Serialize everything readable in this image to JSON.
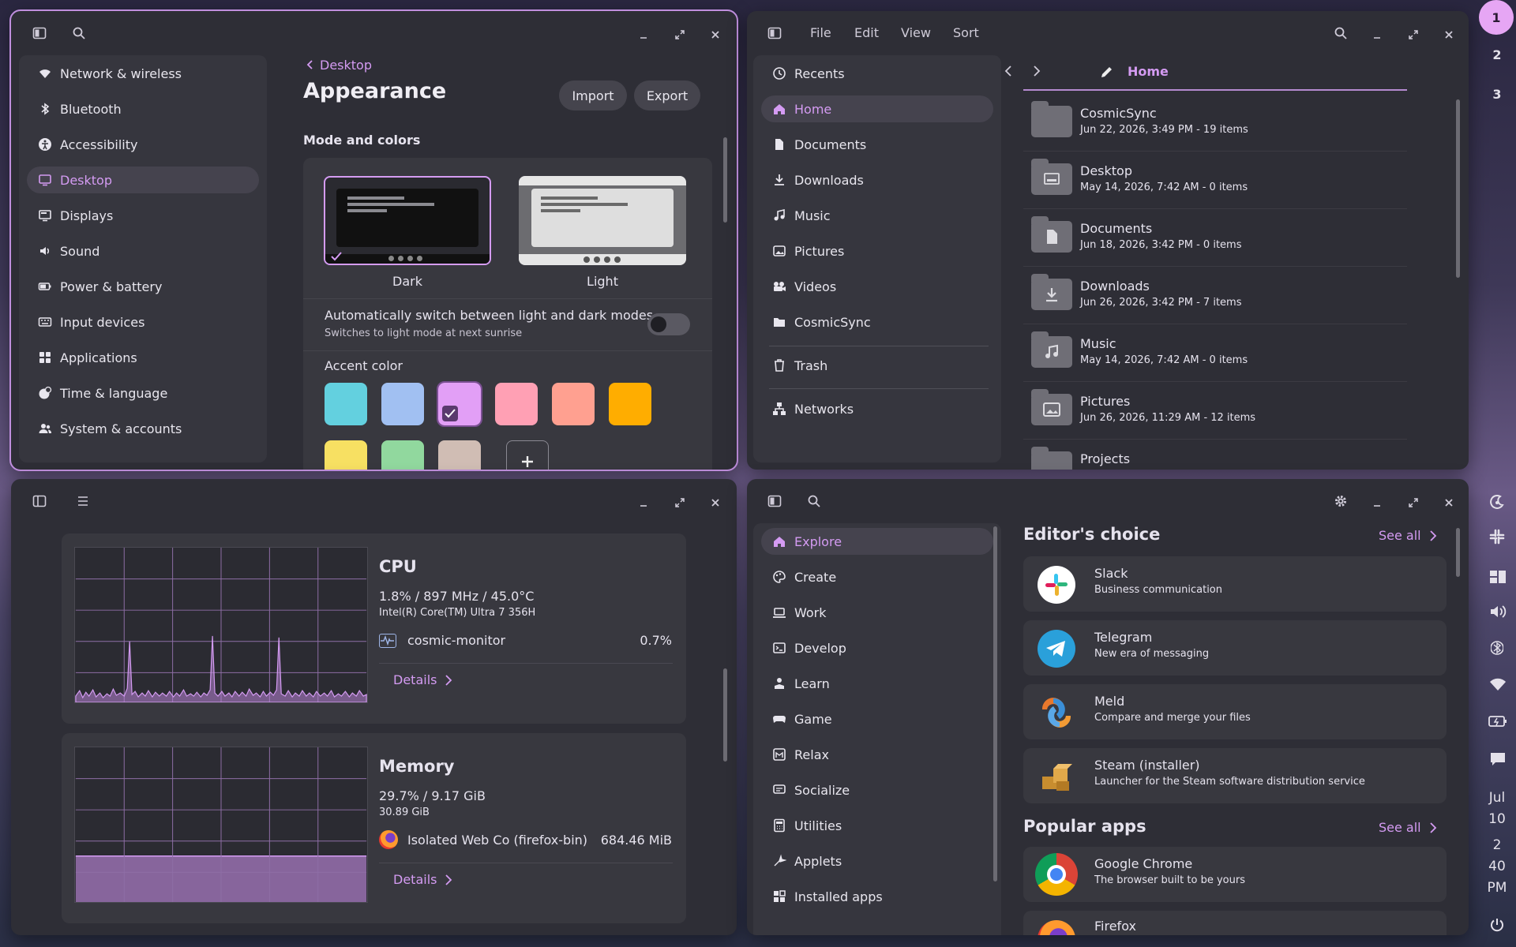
{
  "settings": {
    "nav": [
      "Network & wireless",
      "Bluetooth",
      "Accessibility",
      "Desktop",
      "Displays",
      "Sound",
      "Power & battery",
      "Input devices",
      "Applications",
      "Time & language",
      "System & accounts"
    ],
    "breadcrumb": "Desktop",
    "title": "Appearance",
    "import_label": "Import",
    "export_label": "Export",
    "section_mode": "Mode and colors",
    "dark_label": "Dark",
    "light_label": "Light",
    "auto_title": "Automatically switch between light and dark modes",
    "auto_sub": "Switches to light mode at next sunrise",
    "auto_toggle": false,
    "accent_label": "Accent color",
    "accent_colors": [
      "#63d0df",
      "#a1c0f2",
      "#e29ff6",
      "#ffa0b4",
      "#ffa090",
      "#ffad00",
      "#f7e062",
      "#91d89e",
      "#d0bdb4"
    ],
    "accent_selected": 2
  },
  "files": {
    "menu": [
      "File",
      "Edit",
      "View",
      "Sort"
    ],
    "sidebar": [
      "Recents",
      "Home",
      "Documents",
      "Downloads",
      "Music",
      "Pictures",
      "Videos",
      "CosmicSync",
      "Trash",
      "Networks"
    ],
    "location": "Home",
    "items": [
      {
        "name": "CosmicSync",
        "meta": "Jun 22, 2026, 3:49 PM - 19 items",
        "icon": ""
      },
      {
        "name": "Desktop",
        "meta": "May 14, 2026, 7:42 AM - 0 items",
        "icon": "desktop"
      },
      {
        "name": "Documents",
        "meta": "Jun 18, 2026, 3:42 PM - 0 items",
        "icon": "doc"
      },
      {
        "name": "Downloads",
        "meta": "Jun 26, 2026, 3:42 PM - 7 items",
        "icon": "download"
      },
      {
        "name": "Music",
        "meta": "May 14, 2026, 7:42 AM - 0 items",
        "icon": "music"
      },
      {
        "name": "Pictures",
        "meta": "Jun 26, 2026, 11:29 AM - 12 items",
        "icon": "picture"
      },
      {
        "name": "Projects",
        "meta": "",
        "icon": ""
      }
    ]
  },
  "monitor": {
    "cpu": {
      "title": "CPU",
      "usage": "1.8% / 897 MHz / 45.0°C",
      "model": "Intel(R) Core(TM) Ultra 7 356H",
      "proc": "cosmic-monitor",
      "proc_val": "0.7%",
      "details": "Details"
    },
    "mem": {
      "title": "Memory",
      "usage": "29.7% / 9.17 GiB",
      "total": "30.89 GiB",
      "proc": "Isolated Web Co (firefox-bin)",
      "proc_val": "684.46 MiB",
      "details": "Details",
      "fill_fraction": 0.297
    }
  },
  "store": {
    "nav": [
      "Explore",
      "Create",
      "Work",
      "Develop",
      "Learn",
      "Game",
      "Relax",
      "Socialize",
      "Utilities",
      "Applets",
      "Installed apps"
    ],
    "editors": "Editor's choice",
    "popular": "Popular apps",
    "see_all": "See all",
    "apps": [
      {
        "name": "Slack",
        "desc": "Business communication"
      },
      {
        "name": "Telegram",
        "desc": "New era of messaging"
      },
      {
        "name": "Meld",
        "desc": "Compare and merge your files"
      },
      {
        "name": "Steam (installer)",
        "desc": "Launcher for the Steam software distribution service"
      }
    ],
    "popular_apps": [
      {
        "name": "Google Chrome",
        "desc": "The browser built to be yours"
      },
      {
        "name": "Firefox",
        "desc": ""
      }
    ]
  },
  "dock": {
    "workspaces": [
      "1",
      "2",
      "3"
    ],
    "month": "Jul",
    "day": "10",
    "hour": "2",
    "minute": "40",
    "ampm": "PM"
  }
}
